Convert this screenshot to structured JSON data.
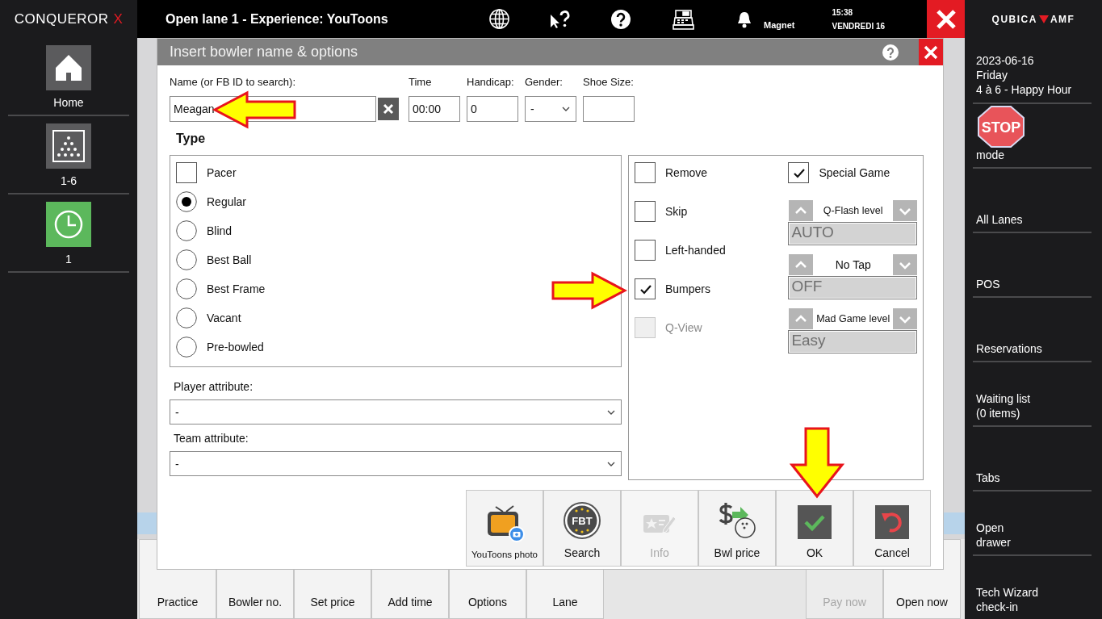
{
  "brand": {
    "name": "CONQUEROR",
    "mark": "X"
  },
  "left_nav": [
    {
      "label": "Home",
      "kind": "home"
    },
    {
      "label": "1-6",
      "kind": "pins"
    },
    {
      "label": "1",
      "kind": "lane"
    }
  ],
  "top_bar": {
    "title": "Open lane 1 - Experience: YouToons",
    "notification": "Magnet",
    "time": "15:38",
    "date": "VENDREDI 16"
  },
  "right_panel": {
    "logo": [
      "QUBICA",
      "AMF"
    ],
    "date": "2023-06-16",
    "day": "Friday",
    "event": "4 à 6 - Happy Hour",
    "items": [
      {
        "label": "mode",
        "kind": "stop",
        "sign": "STOP"
      },
      {
        "label": "All Lanes",
        "kind": "link"
      },
      {
        "label": "POS",
        "kind": "link"
      },
      {
        "label": "Reservations",
        "kind": "link"
      },
      {
        "label": "Waiting list\n(0 items)",
        "kind": "link"
      },
      {
        "label": "Tabs",
        "kind": "link"
      },
      {
        "label": "Open\ndrawer",
        "kind": "link"
      },
      {
        "label": "Tech Wizard\ncheck-in",
        "kind": "link"
      }
    ]
  },
  "toolbar": {
    "left_buttons": [
      {
        "label": "Practice",
        "disabled": false
      },
      {
        "label": "Bowler no.",
        "disabled": false
      },
      {
        "label": "Set price",
        "disabled": false
      },
      {
        "label": "Add time",
        "disabled": false
      },
      {
        "label": "Options",
        "disabled": false
      },
      {
        "label": "Lane",
        "disabled": false
      }
    ],
    "right_buttons": [
      {
        "label": "Pay now",
        "disabled": true
      },
      {
        "label": "Open now",
        "disabled": false
      }
    ]
  },
  "dialog": {
    "title": "Insert bowler name & options",
    "fields": [
      {
        "kind": "name",
        "label": "Name (or FB ID to search):",
        "value": "Meagan"
      },
      {
        "kind": "text",
        "label": "Time",
        "value": "00:00"
      },
      {
        "kind": "text",
        "label": "Handicap:",
        "value": "0"
      },
      {
        "kind": "select",
        "label": "Gender:",
        "value": "-"
      },
      {
        "kind": "text",
        "label": "Shoe Size:"
      }
    ],
    "type_heading": "Type",
    "types": [
      {
        "label": "Pacer",
        "kind": "checkbox",
        "selected": false
      },
      {
        "label": "Regular",
        "kind": "radio",
        "selected": true
      },
      {
        "label": "Blind",
        "kind": "radio",
        "selected": false
      },
      {
        "label": "Best Ball",
        "kind": "radio",
        "selected": false
      },
      {
        "label": "Best Frame",
        "kind": "radio",
        "selected": false
      },
      {
        "label": "Vacant",
        "kind": "radio",
        "selected": false
      },
      {
        "label": "Pre-bowled",
        "kind": "radio",
        "selected": false
      }
    ],
    "attributes": [
      {
        "label": "Player attribute:",
        "value": "-"
      },
      {
        "label": "Team attribute:",
        "value": "-"
      }
    ],
    "options": [
      {
        "label": "Remove",
        "checked": false,
        "disabled": false
      },
      {
        "label": "Skip",
        "checked": false,
        "disabled": false
      },
      {
        "label": "Left-handed",
        "checked": false,
        "disabled": false
      },
      {
        "label": "Bumpers",
        "checked": true,
        "disabled": false
      },
      {
        "label": "Q-View",
        "checked": false,
        "disabled": true
      }
    ],
    "special_game": {
      "label": "Special Game",
      "checked": true
    },
    "spinners": [
      {
        "label": "Q-Flash level",
        "value": "AUTO"
      },
      {
        "label": "No Tap",
        "value": "OFF"
      },
      {
        "label": "Mad Game level",
        "value": "Easy"
      }
    ],
    "buttons": [
      {
        "label": "YouToons photo",
        "kind": "youtoons",
        "disabled": false
      },
      {
        "label": "Search",
        "kind": "fbt",
        "badge": "FBT",
        "disabled": false
      },
      {
        "label": "Info",
        "kind": "info",
        "disabled": true
      },
      {
        "label": "Bwl price",
        "kind": "price",
        "disabled": false
      },
      {
        "label": "OK",
        "kind": "ok",
        "disabled": false
      },
      {
        "label": "Cancel",
        "kind": "cancel",
        "disabled": false
      }
    ]
  }
}
